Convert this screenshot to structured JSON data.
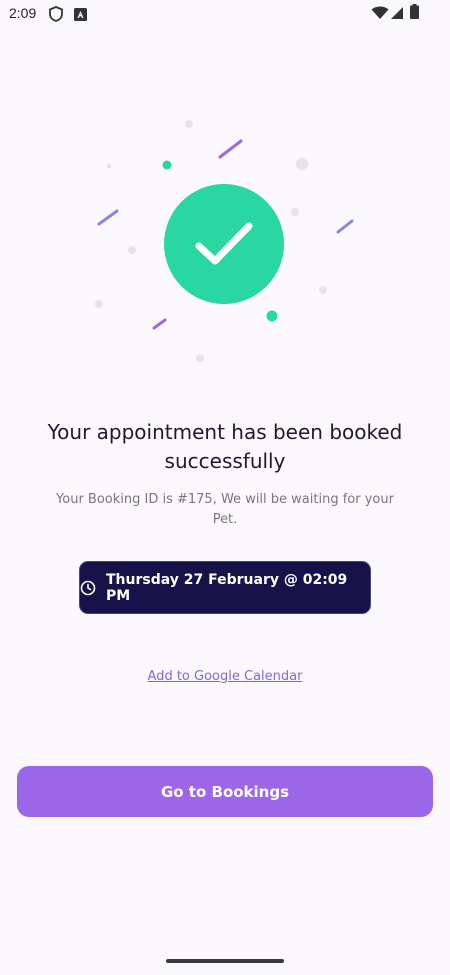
{
  "status_bar": {
    "time": "2:09",
    "icons": [
      "shield-icon",
      "a-badge-icon",
      "wifi-icon",
      "signal-icon",
      "battery-icon"
    ]
  },
  "success": {
    "icon": "check-circle-icon",
    "accent_color": "#28d7a1",
    "title": "Your appointment has been booked successfully",
    "message": "Your Booking ID is #175, We will be waiting for your Pet."
  },
  "appointment": {
    "icon": "clock-icon",
    "datetime": "Thursday 27 February @ 02:09 PM"
  },
  "calendar_link": "Add to Google Calendar",
  "primary_button": {
    "label": "Go to Bookings",
    "color": "#9b66e8"
  }
}
